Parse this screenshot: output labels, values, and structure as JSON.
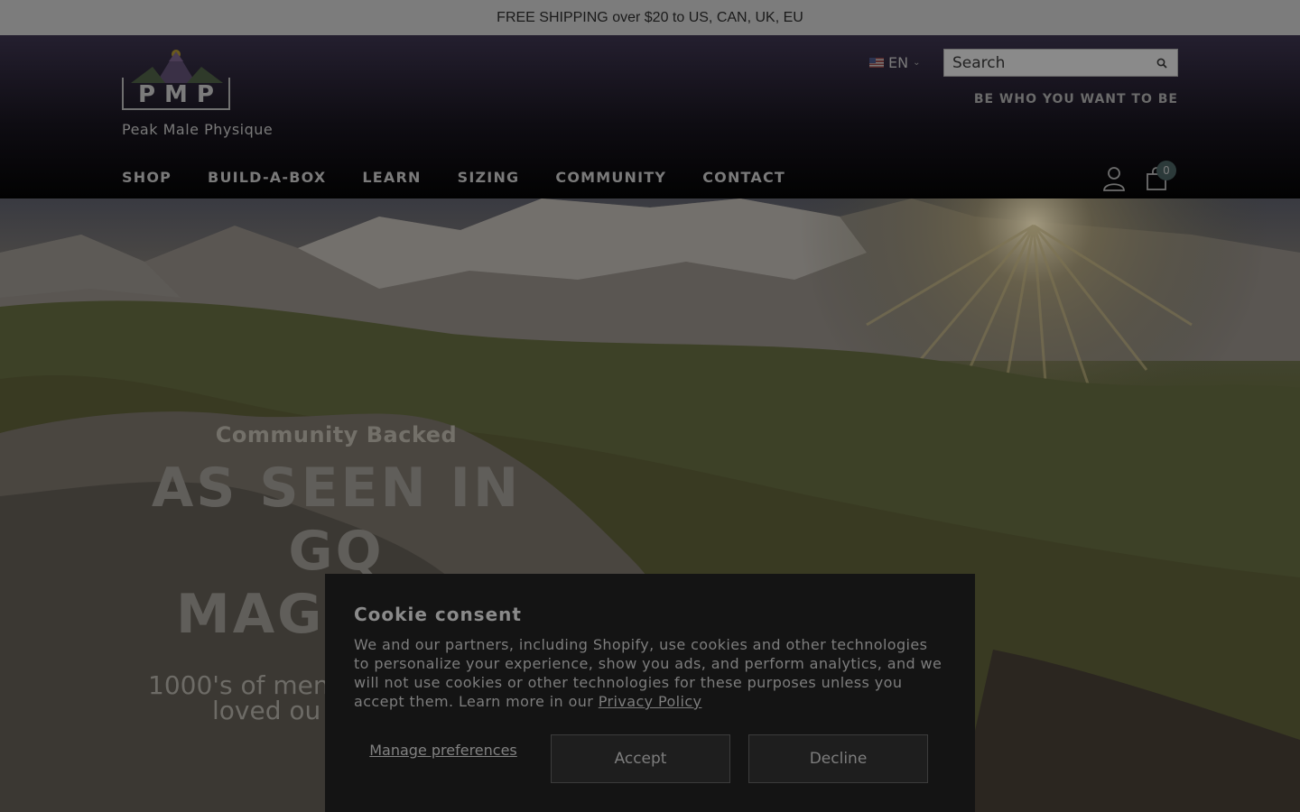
{
  "announcement": {
    "text": "FREE SHIPPING over $20 to US, CAN, UK, EU"
  },
  "header": {
    "logo_text": "PMP",
    "logo_tagline": "Peak Male Physique",
    "language": "EN",
    "search_placeholder": "Search",
    "tagline": "BE WHO YOU WANT TO BE",
    "nav": [
      {
        "label": "SHOP"
      },
      {
        "label": "BUILD-A-BOX"
      },
      {
        "label": "LEARN"
      },
      {
        "label": "SIZING"
      },
      {
        "label": "COMMUNITY"
      },
      {
        "label": "CONTACT"
      }
    ],
    "cart_count": "0"
  },
  "hero": {
    "subtitle": "Community Backed",
    "title_line1": "AS SEEN IN",
    "title_line2": "GQ",
    "title_line3": "MAG.",
    "desc_line1": "1000's of men",
    "desc_line2": "loved ou"
  },
  "cookie": {
    "title": "Cookie consent",
    "body": "We and our partners, including Shopify, use cookies and other technologies to personalize your experience, show you ads, and perform analytics, and we will not use cookies or other technologies for these purposes unless you accept them. Learn more in our ",
    "privacy_link": "Privacy Policy",
    "manage_label": "Manage preferences",
    "accept_label": "Accept",
    "decline_label": "Decline"
  },
  "colors": {
    "announcement_bg": "#7c7c7c",
    "modal_bg": "#141414"
  }
}
